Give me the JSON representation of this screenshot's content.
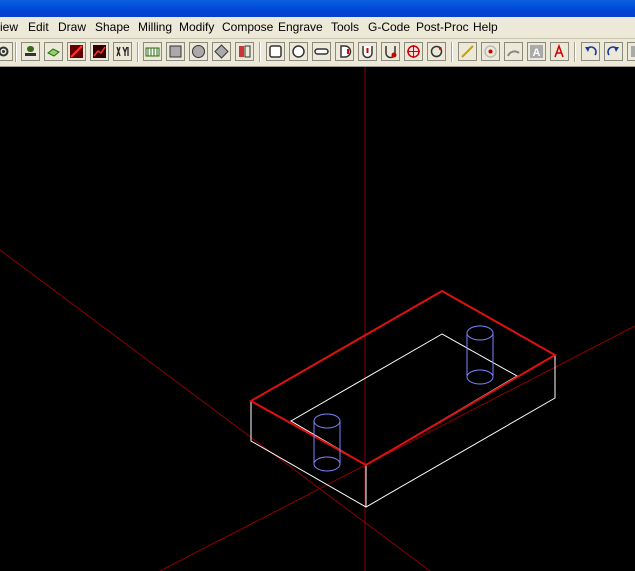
{
  "menu": {
    "items": [
      {
        "id": "view",
        "label": "iew"
      },
      {
        "id": "edit",
        "label": "Edit"
      },
      {
        "id": "draw",
        "label": "Draw"
      },
      {
        "id": "shape",
        "label": "Shape"
      },
      {
        "id": "milling",
        "label": "Milling"
      },
      {
        "id": "modify",
        "label": "Modify"
      },
      {
        "id": "compose",
        "label": "Compose"
      },
      {
        "id": "engrave",
        "label": "Engrave"
      },
      {
        "id": "tools",
        "label": "Tools"
      },
      {
        "id": "gcode",
        "label": "G-Code"
      },
      {
        "id": "postproc",
        "label": "Post-Proc"
      },
      {
        "id": "help",
        "label": "Help"
      }
    ]
  },
  "toolbar": {
    "buttons": [
      "gear-icon",
      "stamp-icon",
      "layer-icon",
      "line-chart-icon",
      "plot-icon",
      "xyz-axes-icon",
      "film-icon",
      "rectangle-icon",
      "circle-icon",
      "diamond-icon",
      "mirror-icon",
      "rounded-rect-icon",
      "circle-pocket-icon",
      "slot-icon",
      "d-shape-icon",
      "cup-icon",
      "u-shape-icon",
      "target-icon",
      "rotate-icon",
      "line-tool-icon",
      "drill-point-icon",
      "arc-icon",
      "text-a-icon",
      "text-edit-icon",
      "undo-icon",
      "redo-icon",
      "extra-icon"
    ],
    "text_label": "A"
  },
  "colors": {
    "background": "#000000",
    "axis": "#8b0000",
    "stock_top": "#e01010",
    "stock_edges": "#ffffff",
    "holes": "#8080ff",
    "chrome": "#ece9d8",
    "titlebar": "#0046d8"
  }
}
